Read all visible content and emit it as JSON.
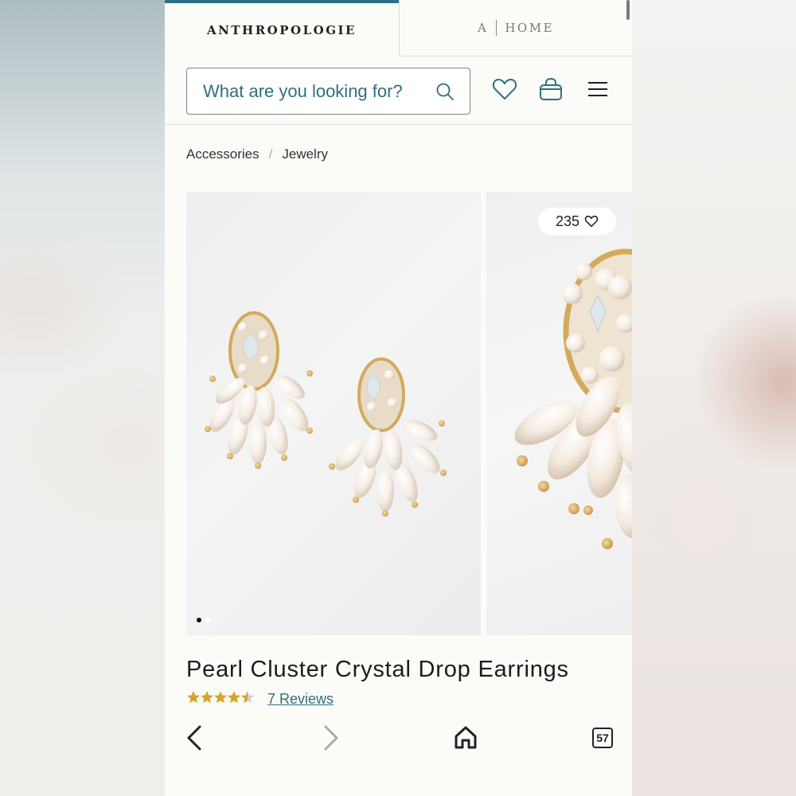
{
  "brand_tabs": {
    "active_label": "ANTHROPOLOGIE",
    "inactive_prefix": "A",
    "inactive_label": "HOME"
  },
  "search": {
    "placeholder": "What are you looking for?"
  },
  "header_icons": [
    "search-icon",
    "heart-icon",
    "shopping-bag-icon",
    "menu-icon"
  ],
  "breadcrumb": {
    "items": [
      "Accessories",
      "Jewelry"
    ],
    "separator": "/"
  },
  "gallery": {
    "favorites_count": "235",
    "dots_count": 2,
    "active_dot": 0
  },
  "product": {
    "title": "Pearl Cluster Crystal Drop Earrings",
    "rating": 4.5,
    "reviews_label": "7 Reviews"
  },
  "browser_bar": {
    "tabs_count": "57"
  },
  "colors": {
    "accent": "#2c6f86",
    "link": "#2f6f80",
    "star": "#d6a42a",
    "page_bg": "#fbfbf8"
  }
}
